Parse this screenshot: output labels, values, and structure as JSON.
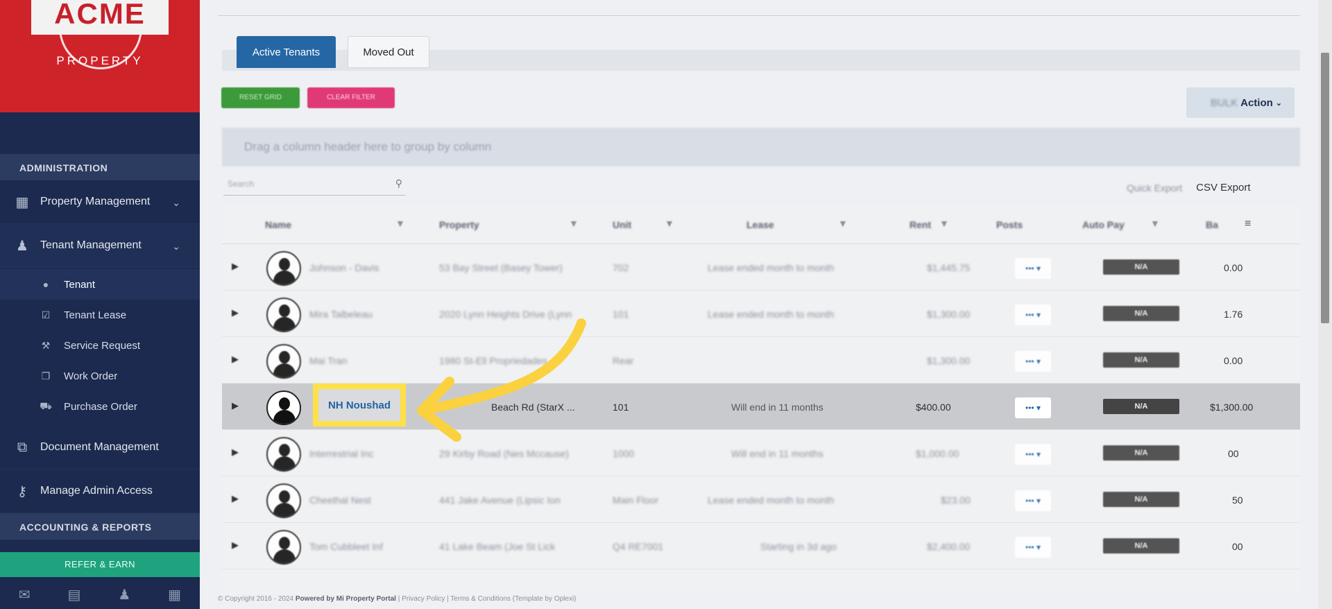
{
  "brand": {
    "logo_text": "ACME",
    "logo_sub": "PROPERTY"
  },
  "sidebar": {
    "section_admin": "ADMINISTRATION",
    "items": [
      {
        "label": "Property Management",
        "icon": "building-icon"
      },
      {
        "label": "Tenant Management",
        "icon": "users-icon"
      },
      {
        "label": "Document Management",
        "icon": "documents-icon"
      },
      {
        "label": "Manage Admin Access",
        "icon": "key-icon"
      }
    ],
    "sub_items": [
      {
        "label": "Tenant",
        "icon": "user-icon"
      },
      {
        "label": "Tenant Lease",
        "icon": "calendar-check-icon"
      },
      {
        "label": "Service Request",
        "icon": "wrench-icon"
      },
      {
        "label": "Work Order",
        "icon": "files-icon"
      },
      {
        "label": "Purchase Order",
        "icon": "truck-icon"
      }
    ],
    "section_accounting": "ACCOUNTING & REPORTS",
    "refer_label": "REFER & EARN",
    "bottom_icons": [
      "mail-icon",
      "briefcase-icon",
      "user-icon",
      "calculator-icon"
    ]
  },
  "tabs": {
    "active": "Active Tenants",
    "moved": "Moved Out"
  },
  "toolbar": {
    "btn_green": "RESET GRID",
    "btn_pink": "CLEAR FILTER",
    "action_prefix": "BULK",
    "action_label": "Action",
    "group_hint": "Drag a column header here to group by column",
    "search_placeholder": "Search",
    "quick_export": "Quick Export",
    "csv_export": "CSV Export"
  },
  "grid": {
    "headers": [
      "Name",
      "Property",
      "Unit",
      "Lease",
      "Rent",
      "Posts",
      "Auto Pay",
      "Ba"
    ],
    "rows": [
      {
        "name": "Johnson - Davis",
        "property": "53 Bay Street (Basey Tower)",
        "unit": "702",
        "lease": "Lease ended month to month",
        "rent": "$1,445.75",
        "badge": "N/A",
        "balance": "0.00"
      },
      {
        "name": "Mira Talbeleau",
        "property": "2020 Lynn Heights Drive (Lynn",
        "unit": "101",
        "lease": "Lease ended month to month",
        "rent": "$1,300.00",
        "badge": "N/A",
        "balance": "1.76"
      },
      {
        "name": "Mai Tran",
        "property": "1980 St-Ell Propriedades",
        "unit": "Rear",
        "lease": "",
        "rent": "$1,300.00",
        "badge": "N/A",
        "balance": "0.00"
      },
      {
        "name": "NH Noushad",
        "property": "Beach Rd (StarX ...",
        "unit": "101",
        "lease": "Will end in 11 months",
        "rent": "$400.00",
        "badge": "N/A",
        "balance": "$1,300.00"
      },
      {
        "name": "Interrestrial Inc",
        "property": "29 Kirby Road (Nes Mccause)",
        "unit": "1000",
        "lease": "Will end in 11 months",
        "rent": "$1,000.00",
        "badge": "N/A",
        "balance": "00"
      },
      {
        "name": "Cheethal Nest",
        "property": "441 Jake Avenue (Lipsic Ion",
        "unit": "Main Floor",
        "lease": "Lease ended month to month",
        "rent": "$23.00",
        "badge": "N/A",
        "balance": "50"
      },
      {
        "name": "Tom Cubbleet Inf",
        "property": "41 Lake Beam (Joe St Lick",
        "unit": "Q4 RE7001",
        "lease": "Starting in 3d ago",
        "rent": "$2,400.00",
        "badge": "N/A",
        "balance": "00"
      }
    ]
  },
  "footer": {
    "copyright": "© Copyright 2016 - 2024",
    "powered": "Powered by Mi Property Portal",
    "links": "| Privacy Policy | Terms & Conditions",
    "template": "(Template by Oplexi)"
  }
}
